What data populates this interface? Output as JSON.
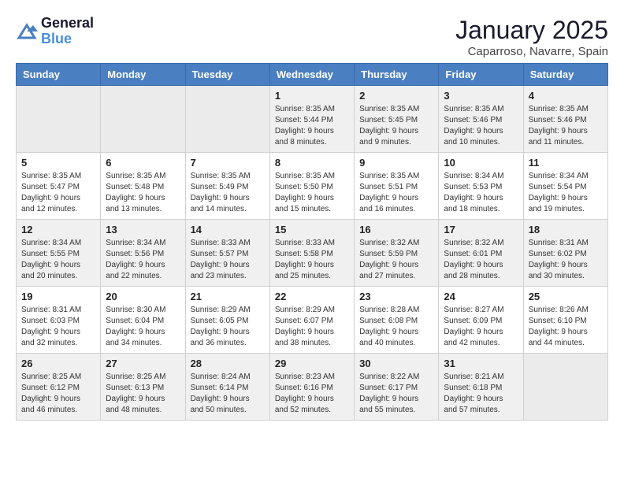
{
  "header": {
    "logo_line1": "General",
    "logo_line2": "Blue",
    "month": "January 2025",
    "location": "Caparroso, Navarre, Spain"
  },
  "weekdays": [
    "Sunday",
    "Monday",
    "Tuesday",
    "Wednesday",
    "Thursday",
    "Friday",
    "Saturday"
  ],
  "weeks": [
    [
      {
        "day": "",
        "info": ""
      },
      {
        "day": "",
        "info": ""
      },
      {
        "day": "",
        "info": ""
      },
      {
        "day": "1",
        "info": "Sunrise: 8:35 AM\nSunset: 5:44 PM\nDaylight: 9 hours\nand 8 minutes."
      },
      {
        "day": "2",
        "info": "Sunrise: 8:35 AM\nSunset: 5:45 PM\nDaylight: 9 hours\nand 9 minutes."
      },
      {
        "day": "3",
        "info": "Sunrise: 8:35 AM\nSunset: 5:46 PM\nDaylight: 9 hours\nand 10 minutes."
      },
      {
        "day": "4",
        "info": "Sunrise: 8:35 AM\nSunset: 5:46 PM\nDaylight: 9 hours\nand 11 minutes."
      }
    ],
    [
      {
        "day": "5",
        "info": "Sunrise: 8:35 AM\nSunset: 5:47 PM\nDaylight: 9 hours\nand 12 minutes."
      },
      {
        "day": "6",
        "info": "Sunrise: 8:35 AM\nSunset: 5:48 PM\nDaylight: 9 hours\nand 13 minutes."
      },
      {
        "day": "7",
        "info": "Sunrise: 8:35 AM\nSunset: 5:49 PM\nDaylight: 9 hours\nand 14 minutes."
      },
      {
        "day": "8",
        "info": "Sunrise: 8:35 AM\nSunset: 5:50 PM\nDaylight: 9 hours\nand 15 minutes."
      },
      {
        "day": "9",
        "info": "Sunrise: 8:35 AM\nSunset: 5:51 PM\nDaylight: 9 hours\nand 16 minutes."
      },
      {
        "day": "10",
        "info": "Sunrise: 8:34 AM\nSunset: 5:53 PM\nDaylight: 9 hours\nand 18 minutes."
      },
      {
        "day": "11",
        "info": "Sunrise: 8:34 AM\nSunset: 5:54 PM\nDaylight: 9 hours\nand 19 minutes."
      }
    ],
    [
      {
        "day": "12",
        "info": "Sunrise: 8:34 AM\nSunset: 5:55 PM\nDaylight: 9 hours\nand 20 minutes."
      },
      {
        "day": "13",
        "info": "Sunrise: 8:34 AM\nSunset: 5:56 PM\nDaylight: 9 hours\nand 22 minutes."
      },
      {
        "day": "14",
        "info": "Sunrise: 8:33 AM\nSunset: 5:57 PM\nDaylight: 9 hours\nand 23 minutes."
      },
      {
        "day": "15",
        "info": "Sunrise: 8:33 AM\nSunset: 5:58 PM\nDaylight: 9 hours\nand 25 minutes."
      },
      {
        "day": "16",
        "info": "Sunrise: 8:32 AM\nSunset: 5:59 PM\nDaylight: 9 hours\nand 27 minutes."
      },
      {
        "day": "17",
        "info": "Sunrise: 8:32 AM\nSunset: 6:01 PM\nDaylight: 9 hours\nand 28 minutes."
      },
      {
        "day": "18",
        "info": "Sunrise: 8:31 AM\nSunset: 6:02 PM\nDaylight: 9 hours\nand 30 minutes."
      }
    ],
    [
      {
        "day": "19",
        "info": "Sunrise: 8:31 AM\nSunset: 6:03 PM\nDaylight: 9 hours\nand 32 minutes."
      },
      {
        "day": "20",
        "info": "Sunrise: 8:30 AM\nSunset: 6:04 PM\nDaylight: 9 hours\nand 34 minutes."
      },
      {
        "day": "21",
        "info": "Sunrise: 8:29 AM\nSunset: 6:05 PM\nDaylight: 9 hours\nand 36 minutes."
      },
      {
        "day": "22",
        "info": "Sunrise: 8:29 AM\nSunset: 6:07 PM\nDaylight: 9 hours\nand 38 minutes."
      },
      {
        "day": "23",
        "info": "Sunrise: 8:28 AM\nSunset: 6:08 PM\nDaylight: 9 hours\nand 40 minutes."
      },
      {
        "day": "24",
        "info": "Sunrise: 8:27 AM\nSunset: 6:09 PM\nDaylight: 9 hours\nand 42 minutes."
      },
      {
        "day": "25",
        "info": "Sunrise: 8:26 AM\nSunset: 6:10 PM\nDaylight: 9 hours\nand 44 minutes."
      }
    ],
    [
      {
        "day": "26",
        "info": "Sunrise: 8:25 AM\nSunset: 6:12 PM\nDaylight: 9 hours\nand 46 minutes."
      },
      {
        "day": "27",
        "info": "Sunrise: 8:25 AM\nSunset: 6:13 PM\nDaylight: 9 hours\nand 48 minutes."
      },
      {
        "day": "28",
        "info": "Sunrise: 8:24 AM\nSunset: 6:14 PM\nDaylight: 9 hours\nand 50 minutes."
      },
      {
        "day": "29",
        "info": "Sunrise: 8:23 AM\nSunset: 6:16 PM\nDaylight: 9 hours\nand 52 minutes."
      },
      {
        "day": "30",
        "info": "Sunrise: 8:22 AM\nSunset: 6:17 PM\nDaylight: 9 hours\nand 55 minutes."
      },
      {
        "day": "31",
        "info": "Sunrise: 8:21 AM\nSunset: 6:18 PM\nDaylight: 9 hours\nand 57 minutes."
      },
      {
        "day": "",
        "info": ""
      }
    ]
  ]
}
